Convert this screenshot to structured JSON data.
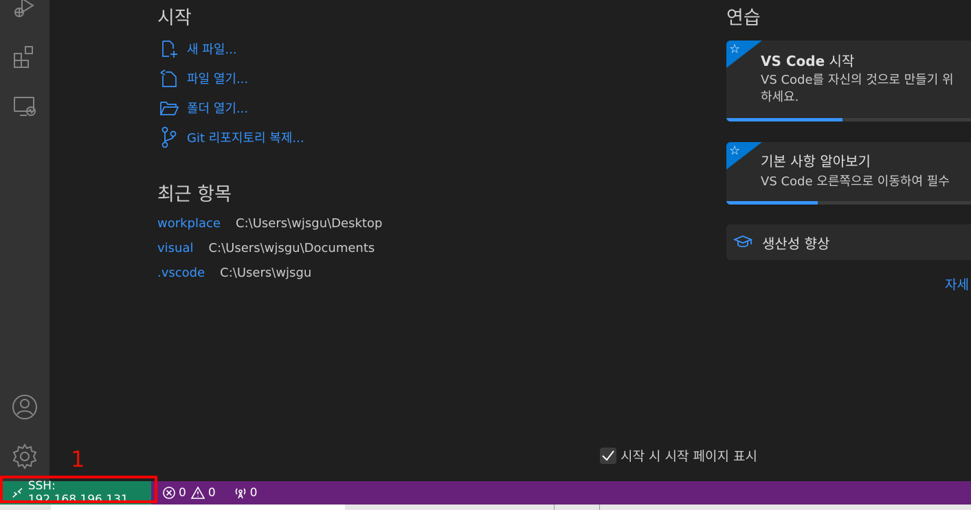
{
  "start": {
    "title": "시작",
    "items": [
      {
        "label": "새 파일...",
        "icon": "new-file-icon"
      },
      {
        "label": "파일 열기...",
        "icon": "open-file-icon"
      },
      {
        "label": "폴더 열기...",
        "icon": "open-folder-icon"
      },
      {
        "label": "Git 리포지토리 복제...",
        "icon": "git-branch-icon"
      }
    ]
  },
  "recent": {
    "title": "최근 항목",
    "items": [
      {
        "name": "workplace",
        "path": "C:\\Users\\wjsgu\\Desktop"
      },
      {
        "name": "visual",
        "path": "C:\\Users\\wjsgu\\Documents"
      },
      {
        "name": ".vscode",
        "path": "C:\\Users\\wjsgu"
      }
    ]
  },
  "walkthroughs": {
    "title": "연습",
    "cards": [
      {
        "title_bold": "VS Code",
        "title_rest": " 시작",
        "desc_line1": "VS Code를 자신의 것으로 만들기 위",
        "desc_line2": "하세요.",
        "progress": 0.47
      },
      {
        "title_bold": "",
        "title_rest": "기본 사항 알아보기",
        "desc_line1": "VS Code 오른쪽으로 이동하여 필수",
        "desc_line2": "",
        "progress": 0.37
      }
    ],
    "productivity": "생산성 향상",
    "more": "자세"
  },
  "footer": {
    "show_on_startup": "시작 시 시작 페이지 표시",
    "checked": true
  },
  "annotation": "1",
  "status_bar": {
    "remote": "SSH: 192.168.196.131",
    "errors": "0",
    "warnings": "0",
    "ports": "0",
    "colors": {
      "bar": "#68217a",
      "remote": "#16825d"
    }
  }
}
